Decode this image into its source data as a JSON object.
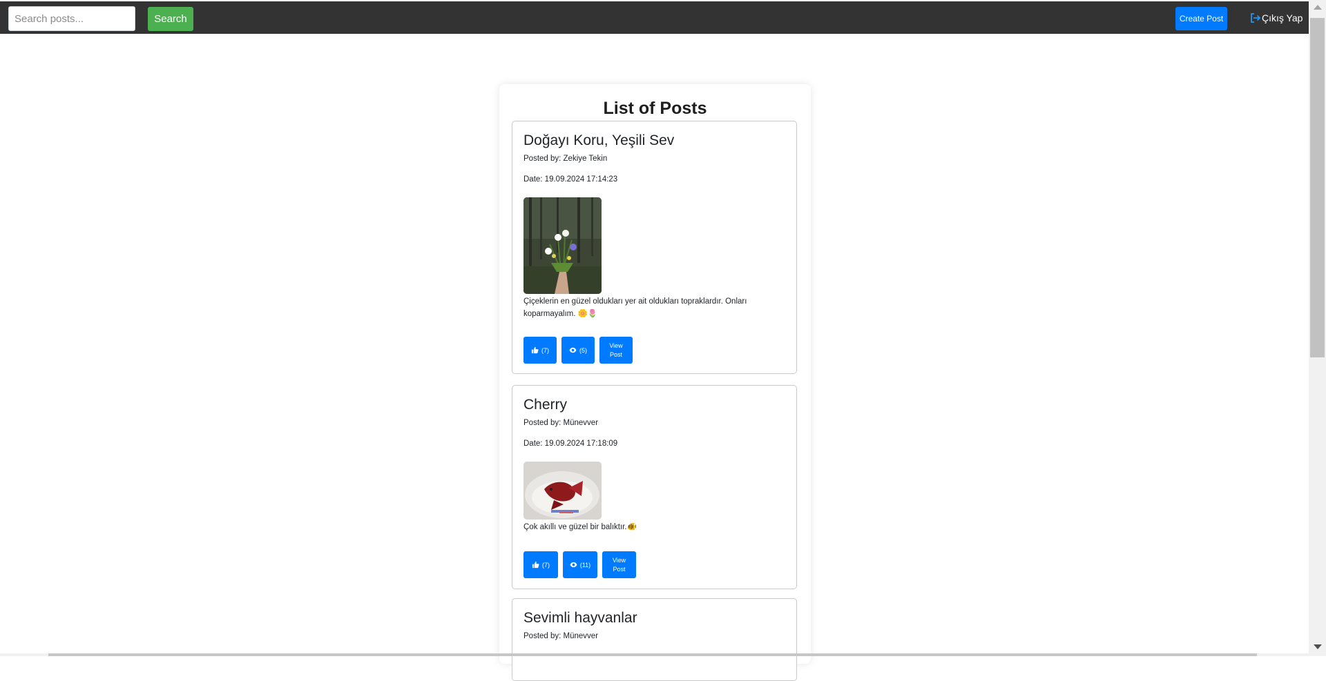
{
  "topbar": {
    "search_placeholder": "Search posts...",
    "search_label": "Search",
    "create_label": "Create Post",
    "logout_label": "Çıkış Yap"
  },
  "page": {
    "title": "List of Posts"
  },
  "posts": [
    {
      "title": "Doğayı Koru, Yeşili Sev",
      "author": "Posted by: Zekiye Tekin",
      "date": "Date: 19.09.2024 17:14:23",
      "content": "Çiçeklerin en güzel oldukları yer ait oldukları topraklardır. Onları koparmayalım. 🌼🌷",
      "likes": "(7)",
      "views": "(5)",
      "view_label": "View Post"
    },
    {
      "title": "Cherry",
      "author": "Posted by: Münevver",
      "date": "Date: 19.09.2024 17:18:09",
      "content": "Çok akıllı ve güzel bir balıktır.🐠",
      "likes": "(7)",
      "views": "(11)",
      "view_label": "View Post"
    },
    {
      "title": "Sevimli hayvanlar",
      "author": "Posted by: Münevver"
    }
  ],
  "icons": {
    "like": "thumbs-up-icon",
    "view": "eye-icon",
    "logout": "sign-out-icon"
  },
  "colors": {
    "topbar": "#333333",
    "search_button": "#4caf50",
    "primary": "#007bff"
  }
}
